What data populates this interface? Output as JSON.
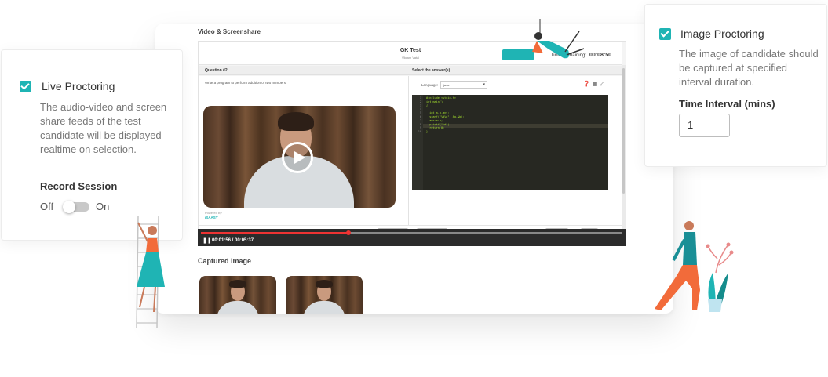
{
  "screen": {
    "title": "Video & Screenshare",
    "test": {
      "title": "GK Test",
      "user": "Vikram Vatal",
      "timer_label": "Time Remaining:",
      "timer_value": "00:08:50"
    },
    "question_header": "Question #2",
    "answer_header": "Select the answer(s)",
    "question_text": "Write a program to perform addition of two numbers.",
    "language_label": "Language:",
    "language_value": "java",
    "code_lines": [
      "#include <stdio.h>",
      "int main()",
      "{",
      "",
      "  int a,b,ans;",
      "  scanf(\"%d%d\", &a,&b);",
      "  ans=a+b;",
      "  printf(\"%d\");",
      "  return 0;",
      "}"
    ],
    "powered_by_label": "Powered By",
    "powered_by_brand": "iSAASY",
    "legend": [
      {
        "label": "Answered",
        "color": "#1fb4b4"
      },
      {
        "label": "Skipped",
        "color": "#444444"
      },
      {
        "label": "Unanswered",
        "color": "#ffffff"
      }
    ],
    "clear_response": "Clear Response",
    "mark_review": "Mark for Review",
    "previous": "< Previous",
    "next": "Next >",
    "playback_time": "00:01:56 / 00:05:37",
    "playback_progress": 0.35,
    "captured_title": "Captured Image"
  },
  "live_card": {
    "title": "Live Proctoring",
    "checked": true,
    "description": "The audio-video and screen share feeds of the test candidate will be displayed realtime on selection.",
    "record_label": "Record Session",
    "toggle_off": "Off",
    "toggle_on": "On",
    "record_on": false
  },
  "image_card": {
    "title": "Image Proctoring",
    "checked": true,
    "description": "The image of candidate should be captured at specified interval duration.",
    "interval_label": "Time Interval (mins)",
    "interval_value": "1"
  },
  "colors": {
    "accent": "#1fb4b4",
    "progress": "#e33333"
  }
}
